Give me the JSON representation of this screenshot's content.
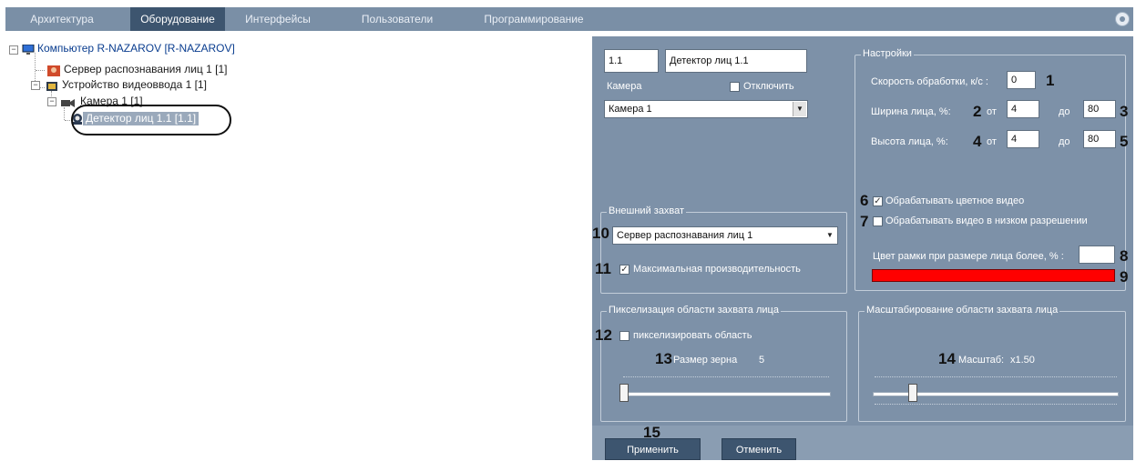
{
  "menu": {
    "items": [
      "Архитектура",
      "Оборудование",
      "Интерфейсы",
      "Пользователи",
      "Программирование"
    ],
    "active_index": 1,
    "settings_icon": "gear-icon"
  },
  "tree": {
    "computer": "Компьютер R-NAZAROV [R-NAZAROV]",
    "face_server": "Сервер распознавания лиц 1 [1]",
    "video_device": "Устройство видеоввода 1 [1]",
    "camera": "Камера 1 [1]",
    "detector": "Детектор лиц 1.1 [1.1]"
  },
  "object": {
    "id": "1.1",
    "name": "Детектор лиц 1.1",
    "camera_label": "Камера",
    "disable_label": "Отключить",
    "camera_value": "Камера 1"
  },
  "settings": {
    "title": "Настройки",
    "speed_label": "Скорость обработки, к/с :",
    "speed_value": "0",
    "width_label": "Ширина лица, %:",
    "height_label": "Высота лица, %:",
    "from_label": "от",
    "to_label": "до",
    "width_from": "4",
    "width_to": "80",
    "height_from": "4",
    "height_to": "80",
    "color_video_label": "Обрабатывать цветное видео",
    "color_video_checked": true,
    "lowres_label": "Обрабатывать видео в низком разрешении",
    "lowres_checked": false,
    "frame_color_label": "Цвет рамки при размере лица более, % :",
    "frame_color_value": "",
    "frame_color": "#ff0000"
  },
  "external": {
    "title": "Внешний захват",
    "server_value": "Сервер распознавания лиц 1",
    "max_perf_label": "Максимальная производительность",
    "max_perf_checked": true
  },
  "pixelation": {
    "title": "Пикселизация области захвата лица",
    "checkbox_label": "пикселизировать область",
    "checked": false,
    "grain_label": "Размер зерна",
    "grain_value": "5",
    "slider_level": 0.0
  },
  "scaling": {
    "title": "Масштабирование области захвата лица",
    "scale_label": "Масштаб:",
    "scale_value": "x1.50",
    "slider_level": 0.15
  },
  "buttons": {
    "apply": "Применить",
    "cancel": "Отменить"
  },
  "callouts": [
    "1",
    "2",
    "3",
    "4",
    "5",
    "6",
    "7",
    "8",
    "9",
    "10",
    "11",
    "12",
    "13",
    "14",
    "15"
  ],
  "colors": {
    "menu_bg": "#7a8fa6",
    "menu_active": "#3d556f",
    "panel_bg": "#7d91a8",
    "frame_color": "#ff0000"
  }
}
